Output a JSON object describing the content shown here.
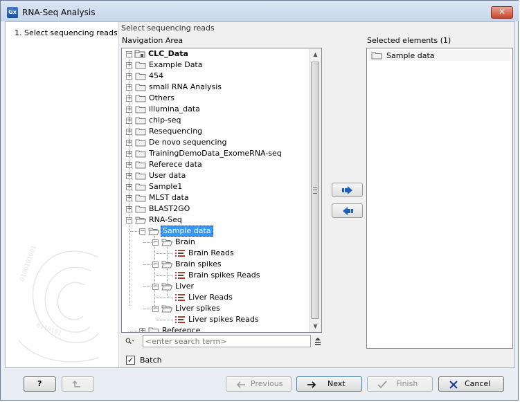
{
  "window": {
    "title": "RNA-Seq Analysis",
    "app_icon_text": "Gx",
    "close_glyph": "✕"
  },
  "steps": [
    {
      "label": "1.  Select sequencing reads"
    }
  ],
  "panel": {
    "heading": "Select sequencing reads",
    "navigation_label": "Navigation Area",
    "selected_label": "Selected elements (1)"
  },
  "tree": {
    "root": "CLC_Data",
    "items": [
      {
        "label": "Example Data",
        "icon": "folder-icon"
      },
      {
        "label": "454",
        "icon": "folder-icon"
      },
      {
        "label": "small RNA Analysis",
        "icon": "folder-icon"
      },
      {
        "label": "Others",
        "icon": "folder-icon"
      },
      {
        "label": "illumina_data",
        "icon": "folder-icon"
      },
      {
        "label": "chip-seq",
        "icon": "folder-icon"
      },
      {
        "label": "Resequencing",
        "icon": "folder-icon"
      },
      {
        "label": "De novo sequencing",
        "icon": "folder-icon"
      },
      {
        "label": "TrainingDemoData_ExomeRNA-seq",
        "icon": "folder-icon"
      },
      {
        "label": "Referece data",
        "icon": "folder-icon"
      },
      {
        "label": "User data",
        "icon": "folder-icon"
      },
      {
        "label": "Sample1",
        "icon": "folder-icon"
      },
      {
        "label": "MLST data",
        "icon": "folder-icon"
      },
      {
        "label": "BLAST2GO",
        "icon": "folder-icon"
      },
      {
        "label": "RNA-Seq",
        "icon": "open-folder-icon"
      },
      {
        "label": "Sample data",
        "icon": "open-folder-icon",
        "selected": true
      },
      {
        "label": "Brain",
        "icon": "open-folder-icon"
      },
      {
        "label": "Brain Reads",
        "icon": "sequence-list-icon"
      },
      {
        "label": "Brain spikes",
        "icon": "open-folder-icon"
      },
      {
        "label": "Brain spikes Reads",
        "icon": "sequence-list-icon"
      },
      {
        "label": "Liver",
        "icon": "open-folder-icon"
      },
      {
        "label": "Liver Reads",
        "icon": "sequence-list-icon"
      },
      {
        "label": "Liver spikes",
        "icon": "open-folder-icon"
      },
      {
        "label": "Liver spikes Reads",
        "icon": "sequence-list-icon"
      },
      {
        "label": "Reference",
        "icon": "folder-icon"
      }
    ]
  },
  "search": {
    "placeholder": "<enter search term>",
    "value": ""
  },
  "batch": {
    "label": "Batch",
    "checked": true,
    "check_glyph": "✓"
  },
  "selected_elements": [
    {
      "label": "Sample data",
      "icon": "folder-icon"
    }
  ],
  "footer": {
    "help_label": "?",
    "previous_label": "Previous",
    "next_label": "Next",
    "finish_label": "Finish",
    "cancel_label": "Cancel"
  },
  "colors": {
    "selection": "#3399ff",
    "arrow_blue": "#1f5fb8",
    "cancel_x": "#1a3fa0"
  }
}
